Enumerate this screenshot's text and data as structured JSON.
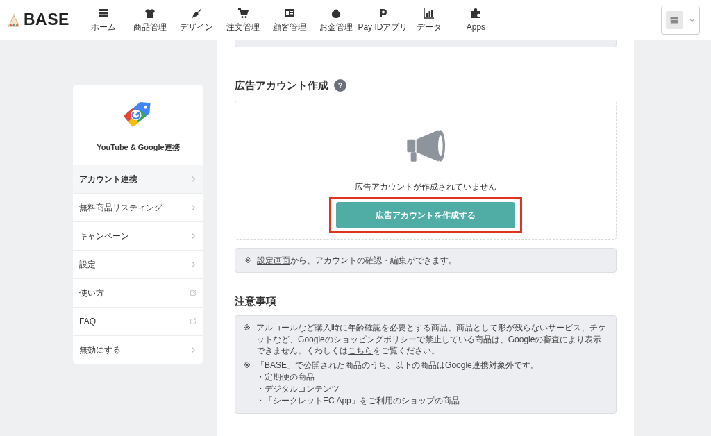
{
  "header": {
    "logo": "BASE",
    "nav": [
      {
        "label": "ホーム"
      },
      {
        "label": "商品管理"
      },
      {
        "label": "デザイン"
      },
      {
        "label": "注文管理"
      },
      {
        "label": "顧客管理"
      },
      {
        "label": "お金管理"
      },
      {
        "label": "Pay IDアプリ"
      },
      {
        "label": "データ"
      },
      {
        "label": "Apps"
      }
    ]
  },
  "sidebar": {
    "title": "YouTube & Google連携",
    "items": [
      {
        "label": "アカウント連携",
        "selected": true,
        "kind": "page"
      },
      {
        "label": "無料商品リスティング",
        "selected": false,
        "kind": "page"
      },
      {
        "label": "キャンペーン",
        "selected": false,
        "kind": "page"
      },
      {
        "label": "設定",
        "selected": false,
        "kind": "page"
      },
      {
        "label": "使い方",
        "selected": false,
        "kind": "external"
      },
      {
        "label": "FAQ",
        "selected": false,
        "kind": "external"
      },
      {
        "label": "無効にする",
        "selected": false,
        "kind": "page"
      }
    ]
  },
  "ad_account": {
    "heading": "広告アカウント作成",
    "help": "?",
    "empty_message": "広告アカウントが作成されていません",
    "button": "広告アカウントを作成する",
    "highlighted": true,
    "note": {
      "mark": "※",
      "link": "設定画面",
      "after": "から、アカウントの確認・編集ができます。"
    }
  },
  "notices": {
    "heading": "注意事項",
    "items": [
      {
        "mark": "※",
        "before": "アルコールなど購入時に年齢確認を必要とする商品、商品として形が残らないサービス、チケットなど、Googleのショッピングポリシーで禁止している商品は、Googleの審査により表示できません。くわしくは",
        "link": "こちら",
        "after": "をご覧ください。"
      },
      {
        "mark": "※",
        "before": "「BASE」で公開された商品のうち、以下の商品はGoogle連携対象外です。",
        "sub_items": [
          "・定期便の商品",
          "・デジタルコンテンツ",
          "・「シークレットEC App」をご利用のショップの商品"
        ]
      }
    ]
  }
}
